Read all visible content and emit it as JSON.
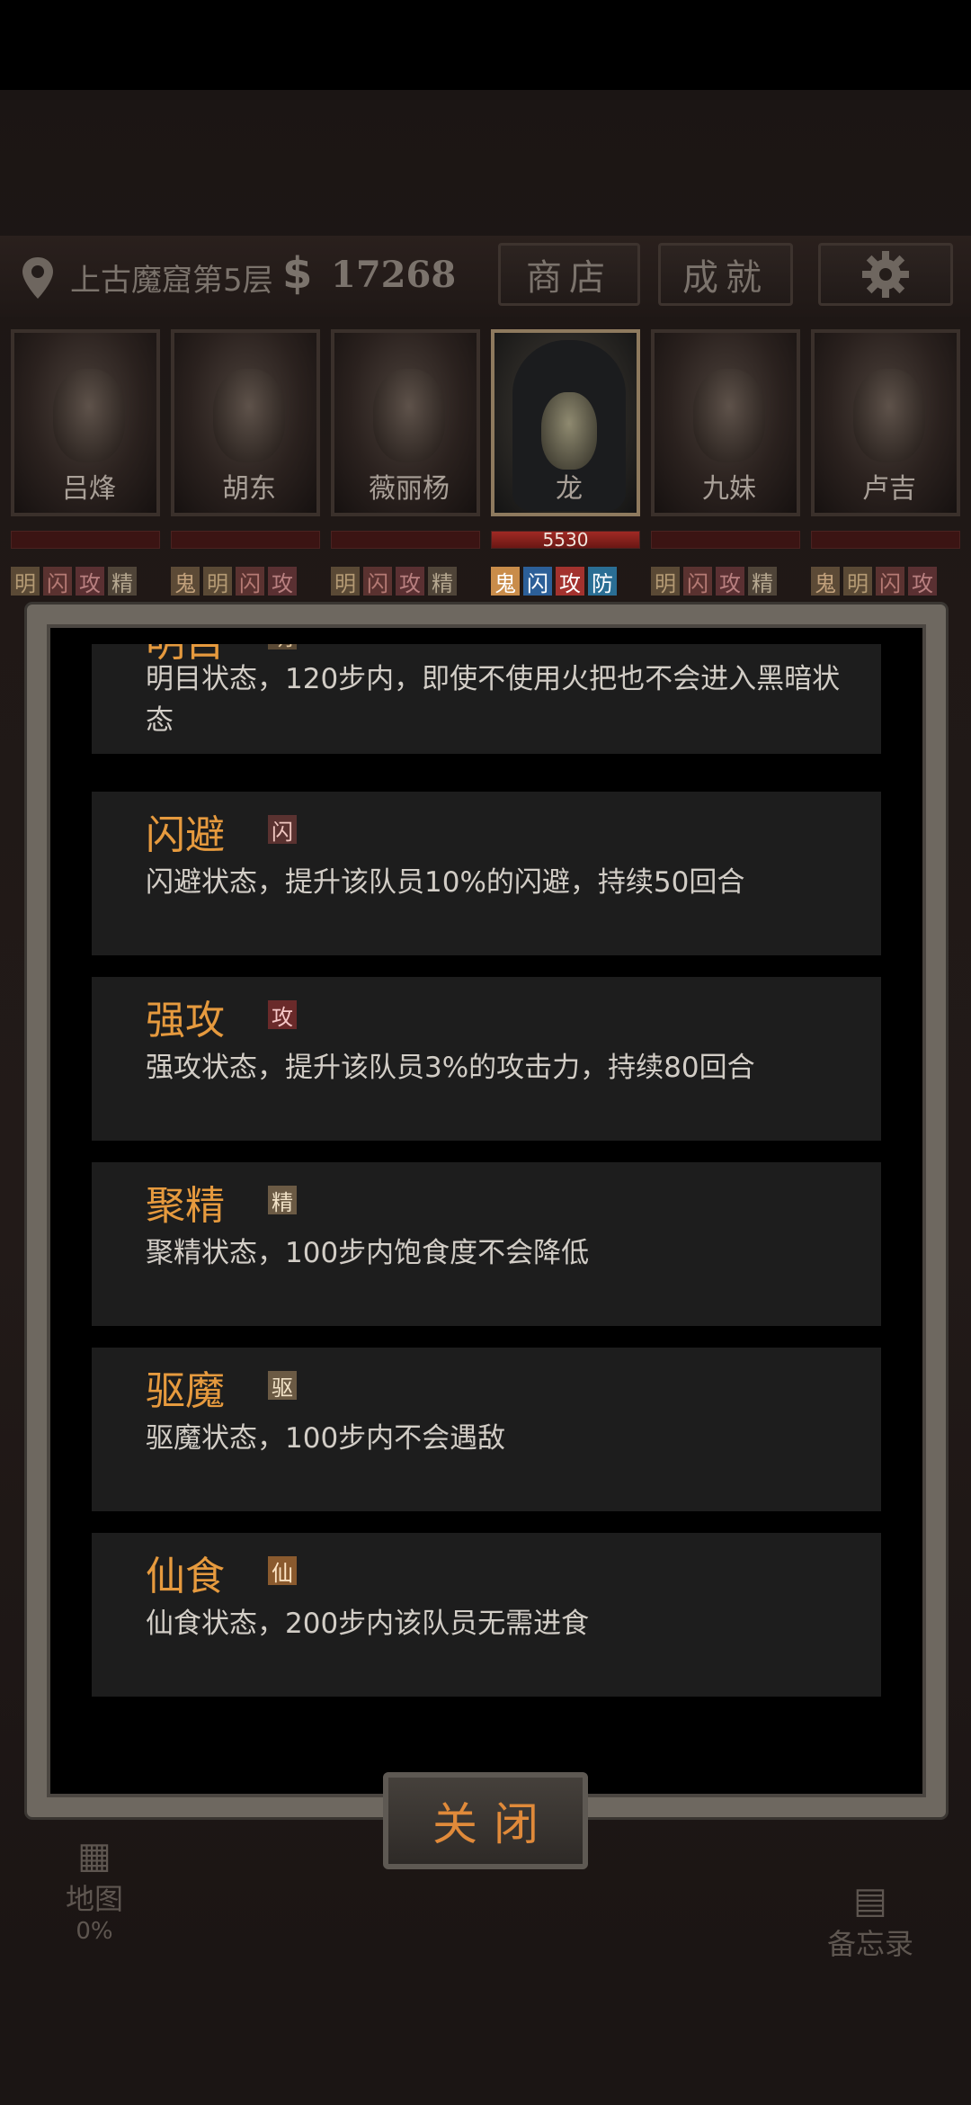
{
  "hud": {
    "location": "上古魔窟第5层",
    "currency_symbol": "$",
    "money": "17268",
    "shop_label": "商店",
    "achievement_label": "成就",
    "settings_icon": "gear-icon"
  },
  "characters": [
    {
      "name": "吕烽",
      "tags": [
        "明",
        "闪",
        "攻",
        "精"
      ],
      "active": false
    },
    {
      "name": "胡东",
      "tags": [
        "鬼",
        "明",
        "闪",
        "攻"
      ],
      "active": false
    },
    {
      "name": "薇丽杨",
      "tags": [
        "明",
        "闪",
        "攻",
        "精"
      ],
      "active": false
    },
    {
      "name": "龙",
      "hp": "5530",
      "tags": [
        "鬼",
        "闪",
        "攻",
        "防"
      ],
      "active": true
    },
    {
      "name": "九妹",
      "tags": [
        "明",
        "闪",
        "攻",
        "精"
      ],
      "active": false
    },
    {
      "name": "卢吉",
      "tags": [
        "鬼",
        "明",
        "闪",
        "攻"
      ],
      "active": false
    }
  ],
  "background": {
    "map_label": "地图",
    "map_progress": "0%",
    "memo_label": "备忘录"
  },
  "modal": {
    "cards": [
      {
        "title": "明目",
        "tag": "明",
        "desc": "明目状态，120步内，即使不使用火把也不会进入黑暗状态"
      },
      {
        "title": "闪避",
        "tag": "闪",
        "desc": "闪避状态，提升该队员10%的闪避，持续50回合"
      },
      {
        "title": "强攻",
        "tag": "攻",
        "desc": "强攻状态，提升该队员3%的攻击力，持续80回合"
      },
      {
        "title": "聚精",
        "tag": "精",
        "desc": "聚精状态，100步内饱食度不会降低"
      },
      {
        "title": "驱魔",
        "tag": "驱",
        "desc": "驱魔状态，100步内不会遇敌"
      },
      {
        "title": "仙食",
        "tag": "仙",
        "desc": "仙食状态，200步内该队员无需进食"
      }
    ],
    "close_label": "关闭"
  },
  "colors": {
    "title_orange": "#e69a3e",
    "card_bg": "#1d1d1d",
    "hp_red": "#a02a24"
  }
}
